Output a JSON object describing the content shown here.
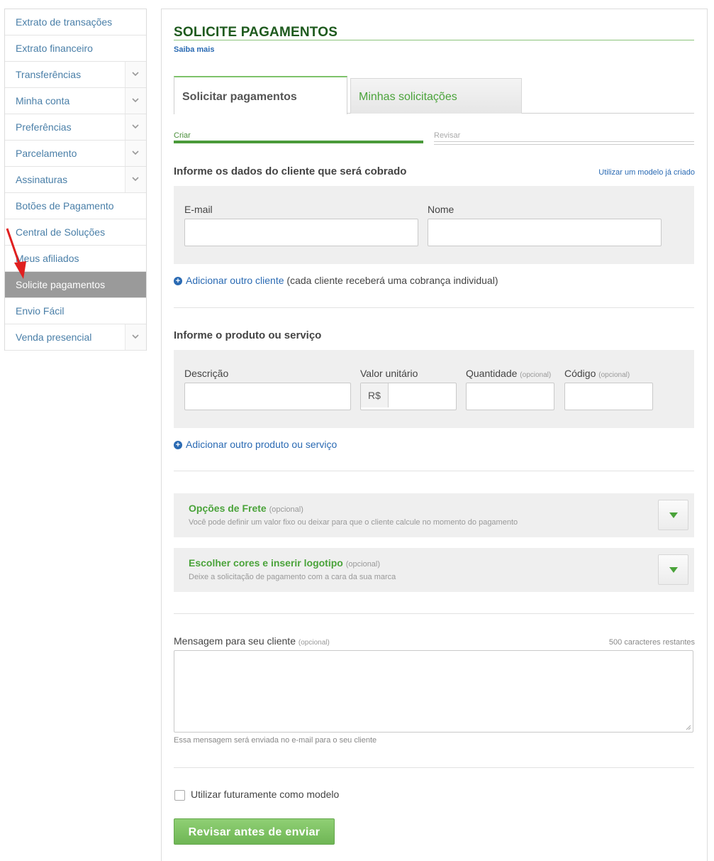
{
  "sidebar": {
    "items": [
      {
        "label": "Extrato de transações",
        "has_chevron": false
      },
      {
        "label": "Extrato financeiro",
        "has_chevron": false
      },
      {
        "label": "Transferências",
        "has_chevron": true
      },
      {
        "label": "Minha conta",
        "has_chevron": true
      },
      {
        "label": "Preferências",
        "has_chevron": true
      },
      {
        "label": "Parcelamento",
        "has_chevron": true
      },
      {
        "label": "Assinaturas",
        "has_chevron": true
      },
      {
        "label": "Botões de Pagamento",
        "has_chevron": false
      },
      {
        "label": "Central de Soluções",
        "has_chevron": false
      },
      {
        "label": "Meus afiliados",
        "has_chevron": false
      },
      {
        "label": "Solicite pagamentos",
        "has_chevron": false,
        "active": true
      },
      {
        "label": "Envio Fácil",
        "has_chevron": false
      },
      {
        "label": "Venda presencial",
        "has_chevron": true
      }
    ]
  },
  "header": {
    "title": "SOLICITE PAGAMENTOS",
    "saiba_mais": "Saiba mais"
  },
  "tabs": [
    {
      "label": "Solicitar pagamentos",
      "active": true
    },
    {
      "label": "Minhas solicitações",
      "active": false
    }
  ],
  "steps": {
    "criar": "Criar",
    "revisar": "Revisar"
  },
  "client_section": {
    "title": "Informe os dados do cliente que será cobrado",
    "template_link": "Utilizar um modelo já criado",
    "email_label": "E-mail",
    "email_value": "",
    "name_label": "Nome",
    "name_value": "",
    "add_client": "Adicionar outro cliente",
    "add_client_note": "(cada cliente receberá uma cobrança individual)"
  },
  "product_section": {
    "title": "Informe o produto ou serviço",
    "description_label": "Descrição",
    "unit_value_label": "Valor unitário",
    "currency_prefix": "R$",
    "quantity_label": "Quantidade",
    "code_label": "Código",
    "optional": "(opcional)",
    "add_product": "Adicionar outro produto ou serviço"
  },
  "accordions": [
    {
      "title": "Opções de Frete",
      "optional": "(opcional)",
      "description": "Você pode definir um valor fixo ou deixar para que o cliente calcule no momento do pagamento"
    },
    {
      "title": "Escolher cores e inserir logotipo",
      "optional": "(opcional)",
      "description": "Deixe a solicitação de pagamento com a cara da sua marca"
    }
  ],
  "message": {
    "label": "Mensagem para seu cliente",
    "optional": "(opcional)",
    "counter": "500 caracteres restantes",
    "value": "",
    "help": "Essa mensagem será enviada no e-mail para o seu cliente"
  },
  "save_template": {
    "label": "Utilizar futuramente como modelo",
    "checked": false
  },
  "submit_label": "Revisar antes de enviar",
  "colors": {
    "accent_green": "#4aa33a",
    "title_green": "#1e5a1e",
    "link_blue": "#2a6ab3",
    "sidebar_active": "#9a9a9a",
    "annotation_arrow": "#e02020"
  }
}
